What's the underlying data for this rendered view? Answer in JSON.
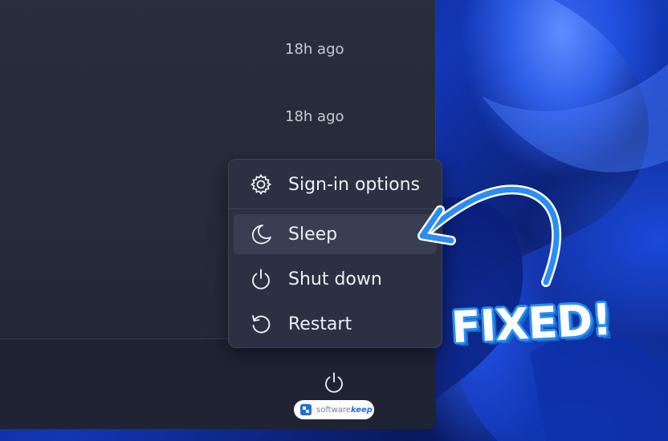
{
  "notifications": [
    {
      "time": "18h ago"
    },
    {
      "time": "18h ago"
    }
  ],
  "power_menu": {
    "items": [
      {
        "label": "Sign-in options",
        "icon": "gear-icon"
      },
      {
        "label": "Sleep",
        "icon": "moon-icon",
        "selected": true
      },
      {
        "label": "Shut down",
        "icon": "power-icon"
      },
      {
        "label": "Restart",
        "icon": "restart-icon"
      }
    ]
  },
  "footer": {
    "power_button_icon": "power-icon"
  },
  "annotation": {
    "text": "FIXED!",
    "color": "#2a8ef0"
  },
  "watermark": {
    "brand_prefix": "software",
    "brand_suffix": "keep"
  },
  "colors": {
    "panel": "#2a2d3b",
    "menu": "#2c3042",
    "menu_selected": "#3a3e52",
    "text": "#eef0f5"
  }
}
